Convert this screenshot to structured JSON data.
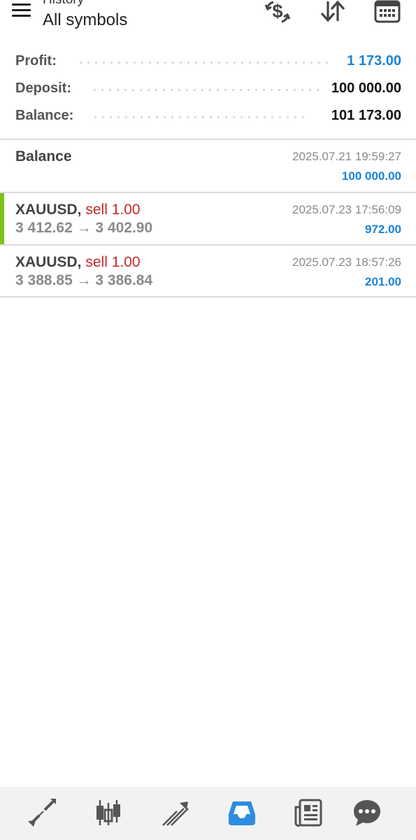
{
  "header": {
    "subtitle": "History",
    "title": "All symbols",
    "actions": [
      "currency-exchange-icon",
      "sort-icon",
      "calendar-icon"
    ]
  },
  "summary": {
    "profit_label": "Profit:",
    "profit_value": "1 173.00",
    "deposit_label": "Deposit:",
    "deposit_value": "100 000.00",
    "balance_label": "Balance:",
    "balance_value": "101 173.00"
  },
  "deals": [
    {
      "title": "Balance",
      "time": "2025.07.21 19:59:27",
      "amount": "100 000.00"
    },
    {
      "symbol": "XAUUSD,",
      "side": "sell 1.00",
      "prices": "3 412.62 → 3 402.90",
      "time": "2025.07.23 17:56:09",
      "amount": "972.00"
    },
    {
      "symbol": "XAUUSD,",
      "side": "sell 1.00",
      "prices": "3 388.85 → 3 386.84",
      "time": "2025.07.23 18:57:26",
      "amount": "201.00"
    }
  ],
  "bottom_nav": {
    "items": [
      "quotes-icon",
      "chart-icon",
      "trade-icon",
      "history-icon",
      "news-icon",
      "messages-icon"
    ],
    "active": "history-icon"
  },
  "colors": {
    "accent_blue": "#1c83d6",
    "sell_red": "#c62828",
    "highlight_green": "#7cc21d",
    "nav_inactive": "#555555"
  }
}
